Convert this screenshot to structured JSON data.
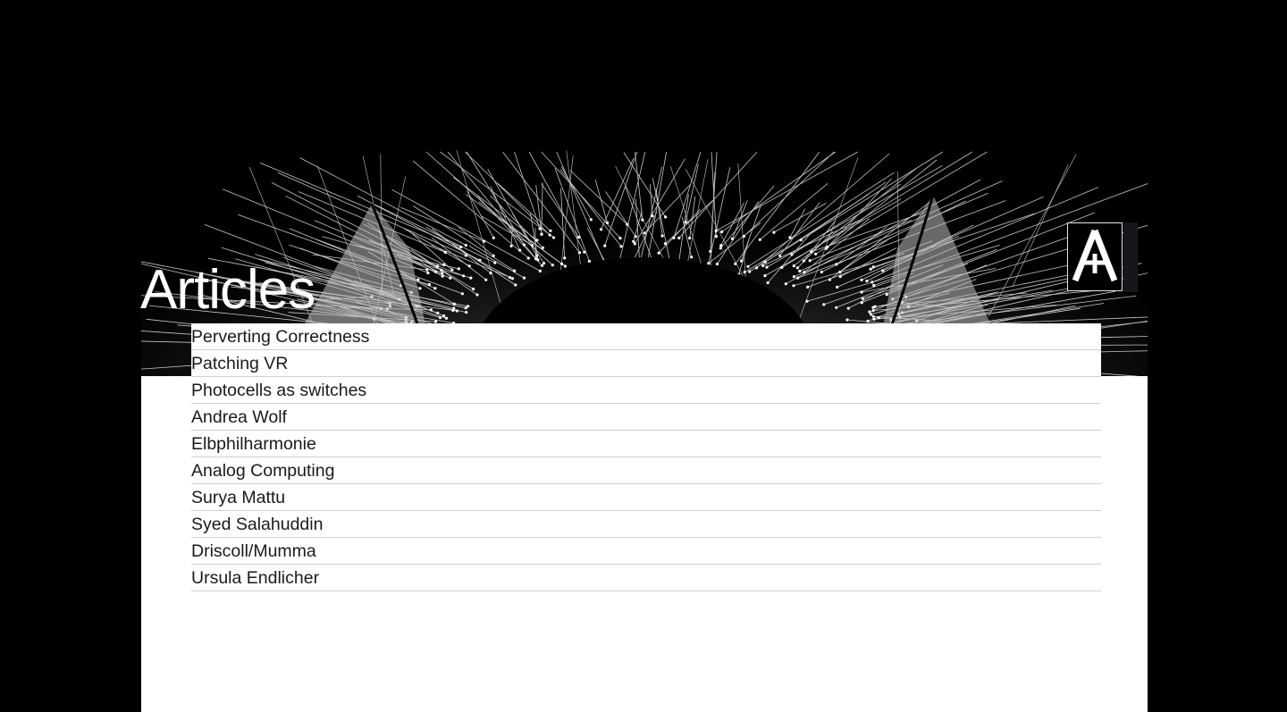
{
  "page": {
    "title": "Articles",
    "background_color": "#000000",
    "panel_color": "#ffffff"
  },
  "logo": {
    "icon": "a-monogram-logo-icon"
  },
  "hero": {
    "image": "wireframe-eye-illustration-icon"
  },
  "articles": [
    {
      "title": "Perverting Correctness"
    },
    {
      "title": "Patching VR"
    },
    {
      "title": "Photocells as switches"
    },
    {
      "title": "Andrea Wolf"
    },
    {
      "title": "Elbphilharmonie"
    },
    {
      "title": "Analog Computing"
    },
    {
      "title": "Surya Mattu"
    },
    {
      "title": "Syed Salahuddin"
    },
    {
      "title": "Driscoll/Mumma"
    },
    {
      "title": "Ursula Endlicher"
    }
  ]
}
